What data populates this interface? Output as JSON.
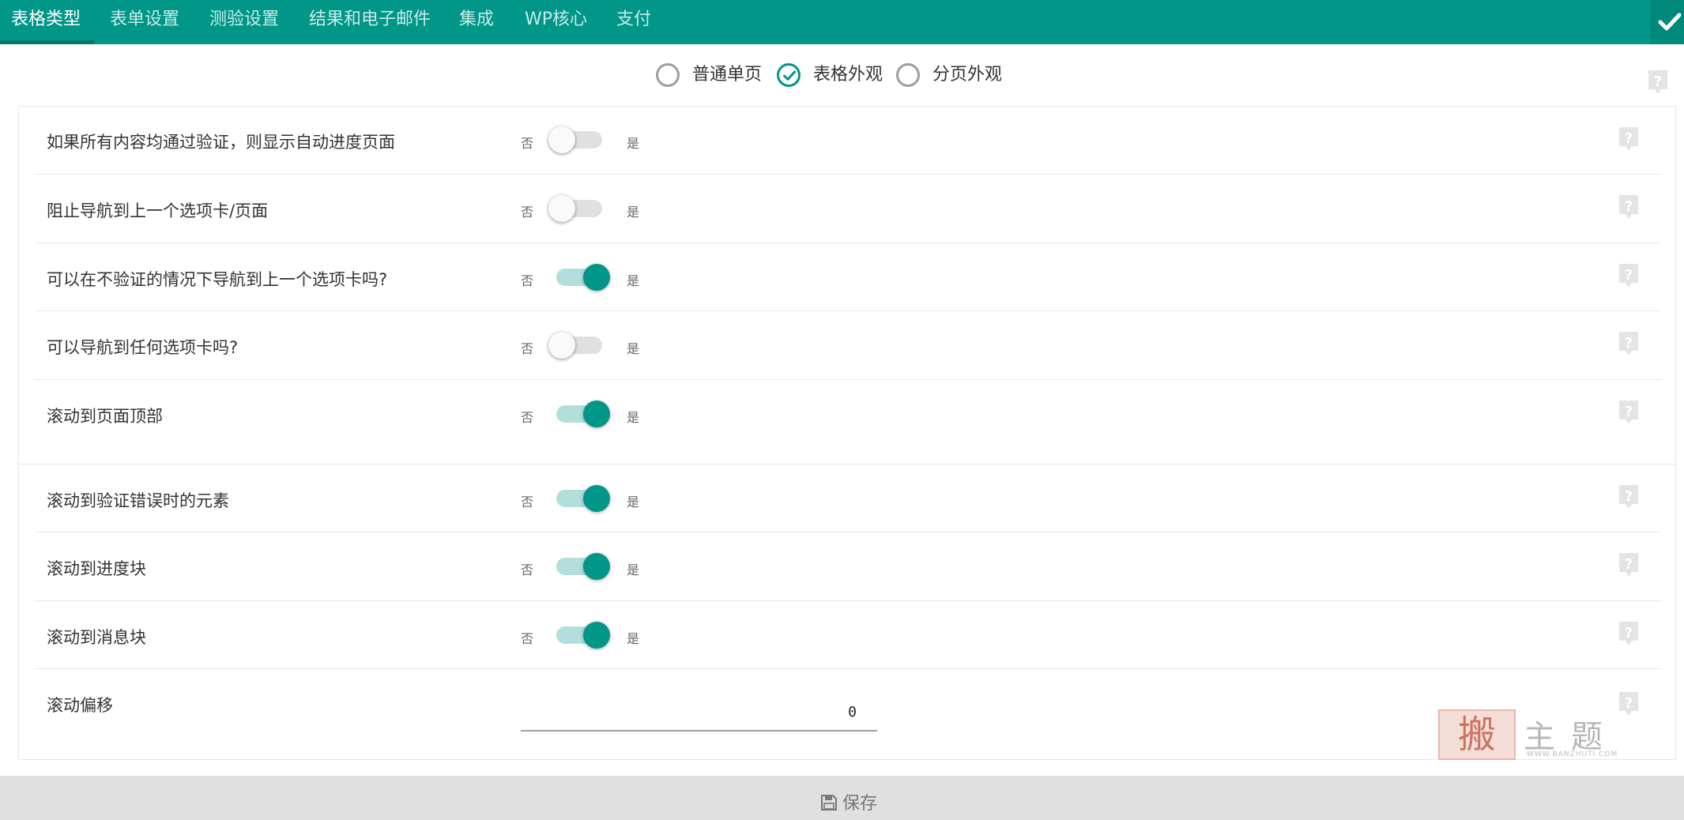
{
  "tabs": [
    {
      "label": "表格类型"
    },
    {
      "label": "表单设置"
    },
    {
      "label": "测验设置"
    },
    {
      "label": "结果和电子邮件"
    },
    {
      "label": "集成"
    },
    {
      "label": "WP核心"
    },
    {
      "label": "支付"
    }
  ],
  "active_tab": "表格类型",
  "form_type": {
    "options": [
      {
        "label": "普通单页",
        "checked": false
      },
      {
        "label": "表格外观",
        "checked": true
      },
      {
        "label": "分页外观",
        "checked": false
      }
    ]
  },
  "settings": {
    "no_label": "否",
    "yes_label": "是",
    "rows": [
      {
        "label": "如果所有内容均通过验证，则显示自动进度页面",
        "enabled": false
      },
      {
        "label": "阻止导航到上一个选项卡/页面",
        "enabled": false
      },
      {
        "label": "可以在不验证的情况下导航到上一个选项卡吗?",
        "enabled": true
      },
      {
        "label": "可以导航到任何选项卡吗?",
        "enabled": false
      },
      {
        "label": "滚动到页面顶部",
        "enabled": true
      },
      {
        "label": "滚动到验证错误时的元素",
        "enabled": true
      },
      {
        "label": "滚动到进度块",
        "enabled": true
      },
      {
        "label": "滚动到消息块",
        "enabled": true
      }
    ],
    "scroll_offset": {
      "label": "滚动偏移",
      "value": "0"
    }
  },
  "footer": {
    "save_label": "保存"
  },
  "watermark": {
    "seal": "搬",
    "text": "主题",
    "small": "WWW.BANZHUTI.COM"
  },
  "colors": {
    "accent": "#009688",
    "accent_dark": "#00796b",
    "toggle_on_track": "#b2dfdb",
    "footer_bg": "#e0e0e0"
  },
  "icons": {
    "confirm": "checkmark-icon",
    "help": "question-icon",
    "save": "floppy-disk-icon"
  }
}
